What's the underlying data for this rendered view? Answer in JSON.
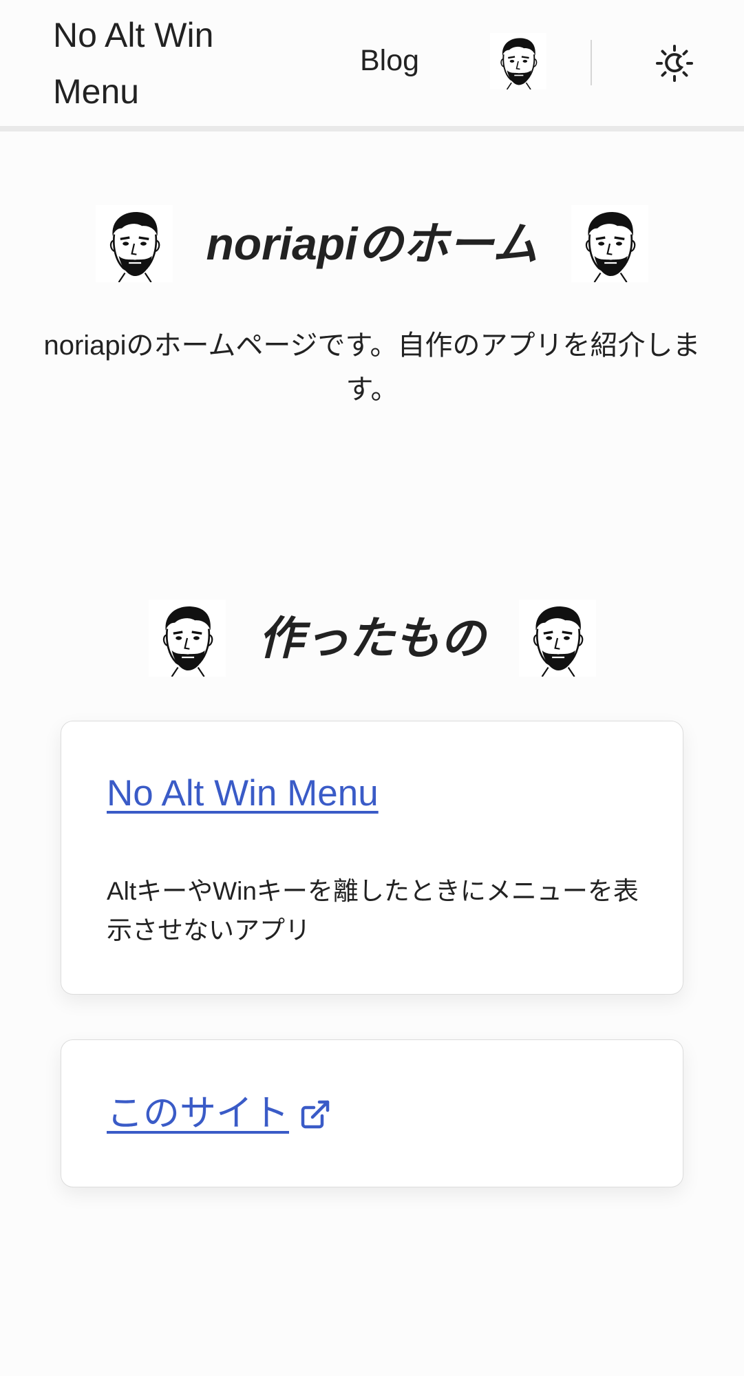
{
  "header": {
    "site_title": "No Alt Win Menu",
    "nav_blog": "Blog",
    "avatar_icon": "noriapi-face-icon",
    "theme_icon": "theme-toggle-sun-icon"
  },
  "hero": {
    "title": "noriapiのホーム",
    "intro": "noriapiのホームページです。自作のアプリを紹介します。",
    "face_icon": "noriapi-face-icon"
  },
  "works": {
    "heading": "作ったもの",
    "items": [
      {
        "title": "No Alt Win Menu",
        "description": "AltキーやWinキーを離したときにメニューを表示させないアプリ"
      },
      {
        "title": "このサイト",
        "icon": "external-link-icon"
      }
    ]
  },
  "colors": {
    "link": "#3a5bc7",
    "text": "#222222",
    "background": "#fcfcfc",
    "card_border": "#dcdcdc"
  }
}
